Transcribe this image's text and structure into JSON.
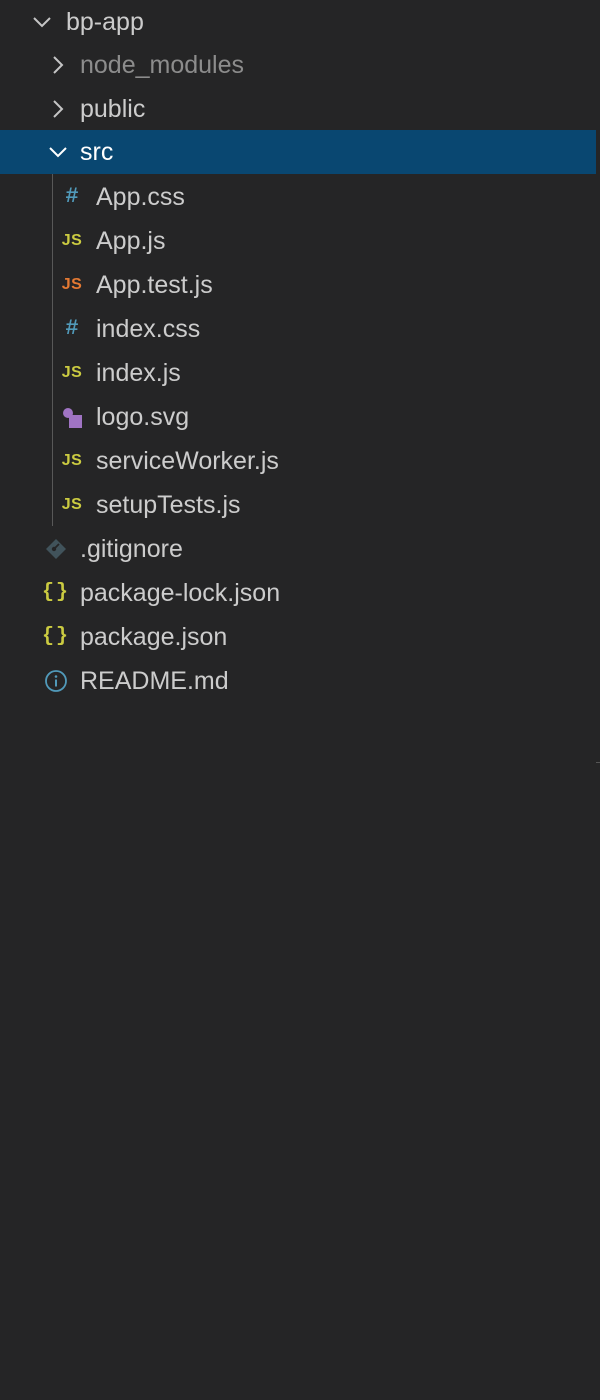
{
  "explorer": {
    "root": {
      "label": "bp-app",
      "expanded": true
    },
    "items": [
      {
        "label": "node_modules",
        "type": "folder",
        "expanded": false,
        "dim": true
      },
      {
        "label": "public",
        "type": "folder",
        "expanded": false
      },
      {
        "label": "src",
        "type": "folder",
        "expanded": true,
        "selected": true
      },
      {
        "label": "App.css",
        "type": "file",
        "icon": "css-hash-icon"
      },
      {
        "label": "App.js",
        "type": "file",
        "icon": "js-icon"
      },
      {
        "label": "App.test.js",
        "type": "file",
        "icon": "js-test-icon"
      },
      {
        "label": "index.css",
        "type": "file",
        "icon": "css-hash-icon"
      },
      {
        "label": "index.js",
        "type": "file",
        "icon": "js-icon"
      },
      {
        "label": "logo.svg",
        "type": "file",
        "icon": "svg-shapes-icon"
      },
      {
        "label": "serviceWorker.js",
        "type": "file",
        "icon": "js-icon"
      },
      {
        "label": "setupTests.js",
        "type": "file",
        "icon": "js-icon"
      },
      {
        "label": ".gitignore",
        "type": "file",
        "icon": "git-diamond-icon"
      },
      {
        "label": "package-lock.json",
        "type": "file",
        "icon": "json-braces-icon"
      },
      {
        "label": "package.json",
        "type": "file",
        "icon": "json-braces-icon"
      },
      {
        "label": "README.md",
        "type": "file",
        "icon": "info-icon"
      }
    ],
    "icon_glyphs": {
      "hash": "#",
      "js": "JS",
      "json": "{}"
    },
    "colors": {
      "background": "#252526",
      "selected_row": "#094771",
      "text": "#cccccc",
      "dim_text": "#8c8c8c",
      "css_icon": "#519aba",
      "js_icon": "#cbcb41",
      "js_test_icon": "#e37933",
      "svg_icon": "#a074c4",
      "git_icon": "#41535b",
      "info_icon": "#519aba"
    }
  }
}
